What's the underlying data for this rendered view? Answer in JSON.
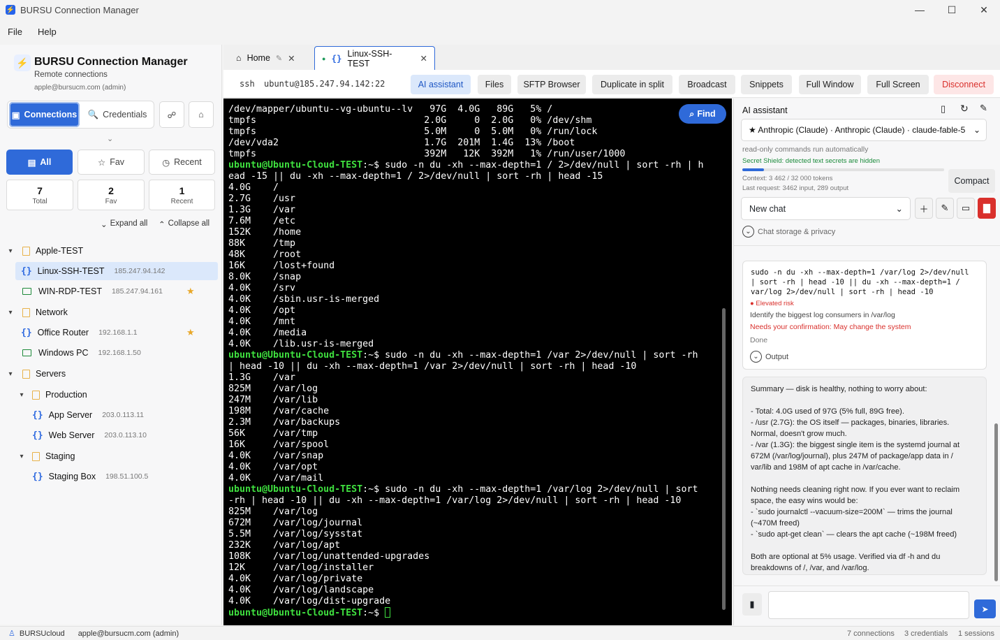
{
  "window": {
    "title": "BURSU Connection Manager",
    "minimize": "—",
    "maximize": "☐",
    "close": "✕"
  },
  "menu": [
    "File",
    "Help"
  ],
  "sidebar": {
    "brand_title": "BURSU Connection Manager",
    "brand_subtitle": "Remote connections",
    "brand_user": "apple@bursucm.com (admin)",
    "tab_connections": "Connections",
    "tab_credentials": "Credentials",
    "filter_all": "All",
    "filter_fav": "Fav",
    "filter_recent": "Recent",
    "stats": [
      {
        "num": "7",
        "label": "Total"
      },
      {
        "num": "2",
        "label": "Fav"
      },
      {
        "num": "1",
        "label": "Recent"
      }
    ],
    "expand_all": "Expand all",
    "collapse_all": "Collapse all",
    "tree": {
      "apple_test": "Apple-TEST",
      "linux_ssh": {
        "name": "Linux-SSH-TEST",
        "host": "185.247.94.142"
      },
      "win_rdp": {
        "name": "WIN-RDP-TEST",
        "host": "185.247.94.161"
      },
      "network": "Network",
      "office_router": {
        "name": "Office Router",
        "host": "192.168.1.1"
      },
      "windows_pc": {
        "name": "Windows PC",
        "host": "192.168.1.50"
      },
      "servers": "Servers",
      "production": "Production",
      "app_server": {
        "name": "App Server",
        "host": "203.0.113.11"
      },
      "web_server": {
        "name": "Web Server",
        "host": "203.0.113.10"
      },
      "staging": "Staging",
      "staging_box": {
        "name": "Staging Box",
        "host": "198.51.100.5"
      }
    }
  },
  "tabs": {
    "home": "Home",
    "active": "Linux-SSH-TEST"
  },
  "toolbar": {
    "protocol": "ssh",
    "target": "ubuntu@185.247.94.142:22",
    "buttons": [
      "AI assistant",
      "Files",
      "SFTP Browser",
      "Duplicate in split",
      "Broadcast",
      "Snippets",
      "Full Window",
      "Full Screen",
      "Disconnect"
    ]
  },
  "terminal": {
    "find": "Find",
    "prompt": "ubuntu@Ubuntu-Cloud-TEST",
    "lines": [
      {
        "t": "/dev/mapper/ubuntu--vg-ubuntu--lv   97G  4.0G   89G   5% /"
      },
      {
        "t": "tmpfs                              2.0G     0  2.0G   0% /dev/shm"
      },
      {
        "t": "tmpfs                              5.0M     0  5.0M   0% /run/lock"
      },
      {
        "t": "/dev/vda2                          1.7G  201M  1.4G  13% /boot"
      },
      {
        "t": "tmpfs                              392M   12K  392M   1% /run/user/1000"
      },
      {
        "p": "ubuntu@Ubuntu-Cloud-TEST",
        "t": ":~$ sudo -n du -xh --max-depth=1 / 2>/dev/null | sort -rh | h"
      },
      {
        "t": "ead -15 || du -xh --max-depth=1 / 2>/dev/null | sort -rh | head -15"
      },
      {
        "t": "4.0G    /"
      },
      {
        "t": "2.7G    /usr"
      },
      {
        "t": "1.3G    /var"
      },
      {
        "t": "7.6M    /etc"
      },
      {
        "t": "152K    /home"
      },
      {
        "t": "88K     /tmp"
      },
      {
        "t": "48K     /root"
      },
      {
        "t": "16K     /lost+found"
      },
      {
        "t": "8.0K    /snap"
      },
      {
        "t": "4.0K    /srv"
      },
      {
        "t": "4.0K    /sbin.usr-is-merged"
      },
      {
        "t": "4.0K    /opt"
      },
      {
        "t": "4.0K    /mnt"
      },
      {
        "t": "4.0K    /media"
      },
      {
        "t": "4.0K    /lib.usr-is-merged"
      },
      {
        "p": "ubuntu@Ubuntu-Cloud-TEST",
        "t": ":~$ sudo -n du -xh --max-depth=1 /var 2>/dev/null | sort -rh"
      },
      {
        "t": "| head -10 || du -xh --max-depth=1 /var 2>/dev/null | sort -rh | head -10"
      },
      {
        "t": "1.3G    /var"
      },
      {
        "t": "825M    /var/log"
      },
      {
        "t": "247M    /var/lib"
      },
      {
        "t": "198M    /var/cache"
      },
      {
        "t": "2.3M    /var/backups"
      },
      {
        "t": "56K     /var/tmp"
      },
      {
        "t": "16K     /var/spool"
      },
      {
        "t": "4.0K    /var/snap"
      },
      {
        "t": "4.0K    /var/opt"
      },
      {
        "t": "4.0K    /var/mail"
      },
      {
        "p": "ubuntu@Ubuntu-Cloud-TEST",
        "t": ":~$ sudo -n du -xh --max-depth=1 /var/log 2>/dev/null | sort"
      },
      {
        "t": "-rh | head -10 || du -xh --max-depth=1 /var/log 2>/dev/null | sort -rh | head -10"
      },
      {
        "t": "825M    /var/log"
      },
      {
        "t": "672M    /var/log/journal"
      },
      {
        "t": "5.5M    /var/log/sysstat"
      },
      {
        "t": "232K    /var/log/apt"
      },
      {
        "t": "108K    /var/log/unattended-upgrades"
      },
      {
        "t": "12K     /var/log/installer"
      },
      {
        "t": "4.0K    /var/log/private"
      },
      {
        "t": "4.0K    /var/log/landscape"
      },
      {
        "t": "4.0K    /var/log/dist-upgrade"
      }
    ],
    "final_prompt_suffix": ":~$ "
  },
  "ai": {
    "title": "AI assistant",
    "model": "★  Anthropic (Claude)  ·  Anthropic (Claude) · claude-fable-5",
    "readonly_note": "read-only commands run automatically",
    "secret_shield": "Secret Shield: detected text secrets are hidden",
    "context": "Context: 3 462 / 32 000 tokens",
    "last_request": "Last request: 3462 input, 289 output",
    "context_fraction": 0.108,
    "compact": "Compact",
    "chat_select": "New chat",
    "storage": "Chat storage & privacy",
    "cmd_card": {
      "command": "sudo -n du -xh --max-depth=1 /var/log 2>/dev/null\n| sort -rh | head -10 || du -xh --max-depth=1 /\nvar/log 2>/dev/null | sort -rh | head -10",
      "risk": "● Elevated risk",
      "purpose": "Identify the biggest log consumers in /var/log",
      "confirm": "Needs your confirmation: May change the system",
      "status": "Done",
      "output": "Output"
    },
    "summary": [
      "Summary — disk is healthy, nothing to worry about:",
      "",
      "- Total: 4.0G used of 97G (5% full, 89G free).",
      "- /usr (2.7G): the OS itself — packages, binaries, libraries.",
      "Normal, doesn't grow much.",
      "- /var (1.3G): the biggest single item is the systemd journal at",
      "672M (/var/log/journal), plus 247M of package/app data in /",
      "var/lib and 198M of apt cache in /var/cache.",
      "",
      "Nothing needs cleaning right now. If you ever want to reclaim",
      "space, the easy wins would be:",
      "- `sudo journalctl --vacuum-size=200M` — trims the journal",
      "(~470M freed)",
      "- `sudo apt-get clean` — clears the apt cache (~198M freed)",
      "",
      "Both are optional at 5% usage. Verified via df -h and du",
      "breakdowns of /, /var, and /var/log."
    ]
  },
  "status": {
    "cloud": "BURSUcloud",
    "user": "apple@bursucm.com (admin)",
    "connections": "7 connections",
    "credentials": "3 credentials",
    "sessions": "1 sessions"
  },
  "colors": {
    "accent": "#2f6ad9",
    "prompt": "#3fe03f",
    "danger": "#d9302c",
    "star": "#e8a82a"
  }
}
